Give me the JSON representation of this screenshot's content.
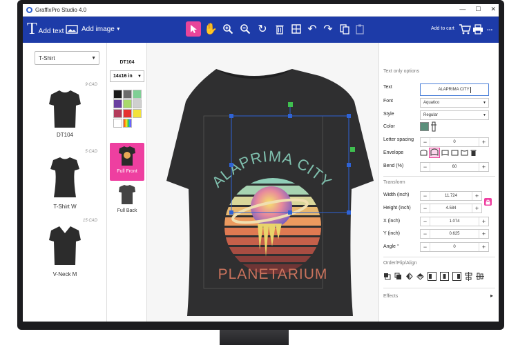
{
  "window": {
    "title": "GraffixPro Studio 4.0"
  },
  "toolbar": {
    "add_text": "Add text",
    "add_image": "Add image",
    "add_to_cart": "Add to cart",
    "more": "..."
  },
  "left": {
    "product_select": "T-Shirt",
    "products": [
      {
        "price": "9 CAD",
        "label": "DT104"
      },
      {
        "price": "5 CAD",
        "label": "T-Shirt W"
      },
      {
        "price": "15 CAD",
        "label": "V-Neck M"
      }
    ]
  },
  "middle": {
    "product_code": "DT104",
    "size_select": "14x16 in",
    "swatches": [
      "#1a1a1a",
      "#6b6b6b",
      "#7fcf95",
      "#6a3fa0",
      "#a8d96b",
      "#cfcfcf",
      "#b23a5a",
      "#e63030",
      "#f2e23a",
      "#ffffff",
      "rainbow"
    ],
    "views": [
      {
        "label": "Full Front"
      },
      {
        "label": "Full Back"
      }
    ]
  },
  "design": {
    "arc_text": "ALAPRIMA CITY",
    "main_text": "PLANETARIUM"
  },
  "panel": {
    "text_section": "Text only options",
    "text_label": "Text",
    "text_value": "ALAPRIMA CITY",
    "font_label": "Font",
    "font_value": "Aquatico",
    "style_label": "Style",
    "style_value": "Regular",
    "color_label": "Color",
    "color_value": "#5b8f7b",
    "spacing_label": "Letter spacing",
    "spacing_value": "0",
    "envelope_label": "Envelope",
    "bend_label": "Bend (%)",
    "bend_value": "60",
    "transform_section": "Transform",
    "width_label": "Width (inch)",
    "width_value": "11.724",
    "height_label": "Height (inch)",
    "height_value": "4.584",
    "x_label": "X (inch)",
    "x_value": "1.074",
    "y_label": "Y (inch)",
    "y_value": "0.625",
    "angle_label": "Angle °",
    "angle_value": "0",
    "order_section": "Order/Flip/Align",
    "effects_section": "Effects"
  }
}
